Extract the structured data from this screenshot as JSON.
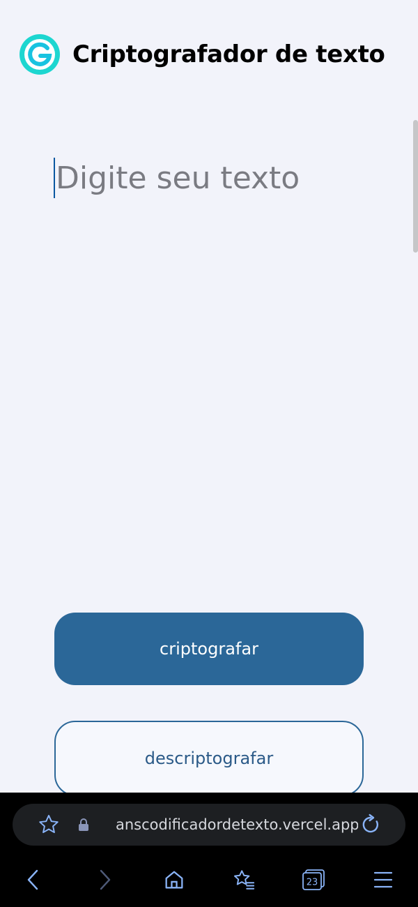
{
  "app": {
    "title": "Criptografador de texto",
    "logo_letter": "G",
    "logo_color": "#1dd6d0"
  },
  "editor": {
    "placeholder": "Digite seu texto",
    "value": ""
  },
  "buttons": {
    "encrypt_label": "criptografar",
    "decrypt_label": "descriptografar",
    "primary_color": "#2b6798"
  },
  "browser": {
    "url": "anscodificadordetexto.vercel.app",
    "tab_count": "23",
    "icons": [
      "bookmark-star-icon",
      "lock-icon",
      "reload-icon",
      "back-icon",
      "forward-icon",
      "home-icon",
      "bookmarks-list-icon",
      "tabs-icon",
      "menu-icon"
    ]
  }
}
